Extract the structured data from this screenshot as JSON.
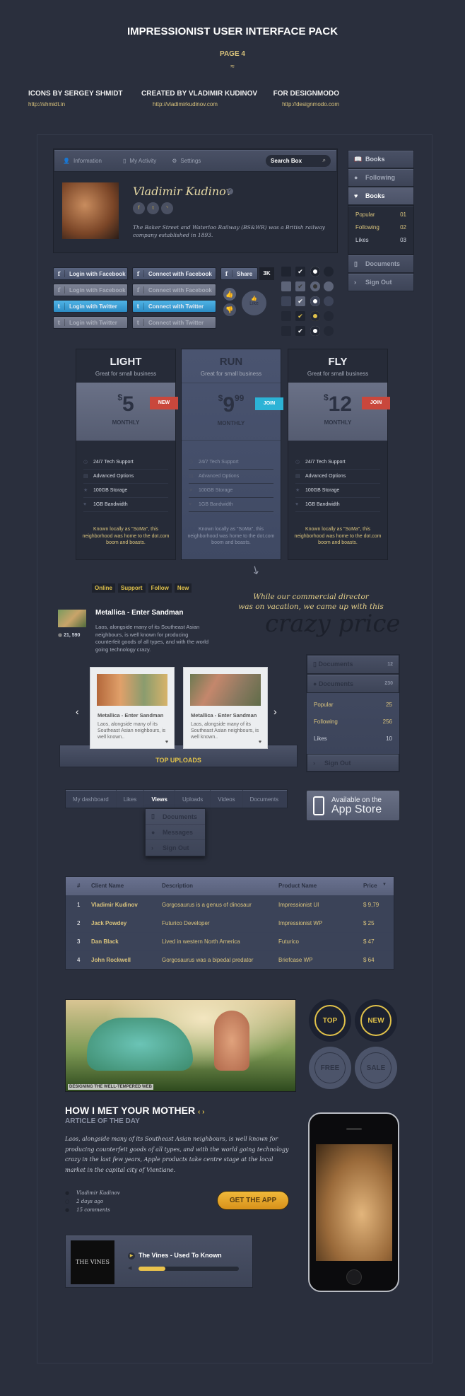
{
  "header": {
    "title": "IMPRESSIONIST USER INTERFACE PACK",
    "page": "PAGE 4",
    "credits": [
      {
        "heading": "ICONS BY SERGEY SHMIDT",
        "url": "http://shmidt.in"
      },
      {
        "heading": "CREATED BY VLADIMIR KUDINOV",
        "url": "http://vladimirkudinov.com"
      },
      {
        "heading": "FOR DESIGNMODO",
        "url": "http://designmodo.com"
      }
    ]
  },
  "profile": {
    "nav": [
      "Information",
      "My Activity",
      "Settings"
    ],
    "search_placeholder": "Search Box",
    "name": "Vladimir Kudinov",
    "social": [
      "f",
      "t",
      "rss"
    ],
    "bio": "The Baker Street and Waterloo Railway (BS&WR) was a British railway company established in 1893."
  },
  "sidebar": {
    "items": [
      "Books",
      "Following",
      "Books"
    ],
    "stats": [
      {
        "label": "Popular",
        "value": "01"
      },
      {
        "label": "Following",
        "value": "02"
      },
      {
        "label": "Likes",
        "value": "03"
      }
    ],
    "bottom": [
      "Documents",
      "Sign Out"
    ]
  },
  "social_buttons": {
    "col1": [
      "Login with Facebook",
      "Login with Facebook",
      "Login with Twitter",
      "Login with Twitter"
    ],
    "col2": [
      "Connect with Facebook",
      "Connect with Facebook",
      "Connect with Twitter",
      "Connect with Twitter"
    ],
    "share": "Share",
    "share_count": "3K",
    "like": "Like"
  },
  "pricing": [
    {
      "name": "LIGHT",
      "sub": "Great for small business",
      "currency": "$",
      "price": "5",
      "cents": "",
      "period": "MONTHLY",
      "ribbon": "NEW",
      "ribbon_color": "#c9473c",
      "features": [
        "24/7 Tech Support",
        "Advanced Options",
        "100GB Storage",
        "1GB Bandwidth"
      ],
      "desc": "Known locally as \"SoMa\", this neighborhood was home to the dot.com boom and boasts."
    },
    {
      "name": "RUN",
      "sub": "Great for small business",
      "currency": "$",
      "price": "9",
      "cents": "99",
      "period": "MONTHLY",
      "ribbon": "JOIN",
      "ribbon_color": "#2cb3d6",
      "features": [
        "24/7 Tech Support",
        "Advanced Options",
        "100GB Storage",
        "1GB Bandwidth"
      ],
      "desc": "Known locally as \"SoMa\", this neighborhood was home to the dot.com boom and boasts."
    },
    {
      "name": "FLY",
      "sub": "Great for small business",
      "currency": "$",
      "price": "12",
      "cents": "",
      "period": "MONTHLY",
      "ribbon": "JOIN",
      "ribbon_color": "#c9473c",
      "features": [
        "24/7 Tech Support",
        "Advanced Options",
        "100GB Storage",
        "1GB Bandwidth"
      ],
      "desc": "Known locally as \"SoMa\", this neighborhood was home to the dot.com boom and boasts."
    }
  ],
  "tags": [
    "Online",
    "Support",
    "Follow",
    "New"
  ],
  "promo": {
    "line1": "While our commercial director",
    "line2": "was on vacation, we came up with this",
    "big": "crazy price"
  },
  "post": {
    "title": "Metallica - Enter Sandman",
    "views": "21, 590",
    "text": "Laos, alongside many of its Southeast Asian neighbours, is well known for producing counterfeit goods of all types, and with the world going technology crazy."
  },
  "uploads": {
    "label": "TOP UPLOADS",
    "cards": [
      {
        "title": "Metallica - Enter Sandman",
        "text": "Laos, alongside many of its Southeast Asian neighbours, is well known.."
      },
      {
        "title": "Metallica - Enter Sandman",
        "text": "Laos, alongside many of its Southeast Asian neighbours, is well known.."
      }
    ]
  },
  "side2": {
    "items": [
      {
        "label": "Documents",
        "count": "12"
      },
      {
        "label": "Documents",
        "count": "230"
      }
    ],
    "stats": [
      {
        "label": "Popular",
        "value": "25"
      },
      {
        "label": "Following",
        "value": "256"
      },
      {
        "label": "Likes",
        "value": "10"
      }
    ],
    "signout": "Sign Out"
  },
  "tabs": {
    "items": [
      "My dashboard",
      "Likes",
      "Views",
      "Uploads",
      "Videos",
      "Documents"
    ],
    "active": "Views",
    "dropdown": [
      "Documents",
      "Messages",
      "Sign Out"
    ]
  },
  "appstore": {
    "line1": "Available on the",
    "line2": "App Store"
  },
  "table": {
    "headers": [
      "#",
      "Client Name",
      "Description",
      "Product Name",
      "Price"
    ],
    "rows": [
      [
        "1",
        "Vladimir Kudinov",
        "Gorgosaurus is a genus of dinosaur",
        "Impressionist UI",
        "$ 9,79"
      ],
      [
        "2",
        "Jack Powdey",
        "Futurico Developer",
        "Impressionist WP",
        "$ 25"
      ],
      [
        "3",
        "Dan Black",
        "Lived in western North America",
        "Futurico",
        "$ 47"
      ],
      [
        "4",
        "John Rockwell",
        "Gorgosaurus was a bipedal predator",
        "Briefcase WP",
        "$ 64"
      ]
    ]
  },
  "banner": {
    "caption": "DESIGNING THE WELL-TEMPERED WEB"
  },
  "badges": [
    "TOP",
    "NEW",
    "FREE",
    "SALE"
  ],
  "article": {
    "title": "HOW I MET YOUR MOTHER",
    "subtitle": "ARTICLE OF THE DAY",
    "text": "Laos, alongside many of its Southeast Asian neighbours, is well known for producing counterfeit goods of all types, and with the world going technology crazy in the last few years, Apple products take centre stage at the local market in the capital city of Vientiane.",
    "meta": [
      "Vladimir Kudinov",
      "2 days ago",
      "15 comments"
    ],
    "cta": "GET THE APP"
  },
  "player": {
    "track": "The Vines - Used To Known",
    "album_art": "THE VINES",
    "progress": 0.27
  },
  "colors": {
    "accent": "#e1c24a",
    "background": "#2a2f3d",
    "twitter": "#3aa0d8"
  }
}
